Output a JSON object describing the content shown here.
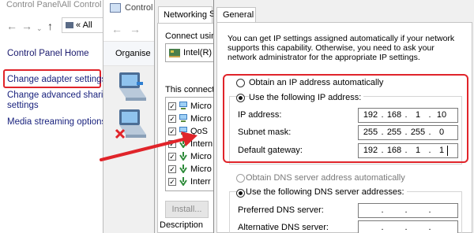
{
  "control_panel": {
    "title": "Control Panel\\All Control",
    "address": "« All",
    "home_link": "Control Panel Home",
    "links": [
      "Change adapter settings",
      "Change advanced sharing",
      "settings",
      "Media streaming options"
    ],
    "highlight_color": "#e0242a"
  },
  "network_connections": {
    "title": "Control",
    "toolbar_label": "Organise",
    "adapters": [
      "network-adapter-icon",
      "network-adapter-disabled-icon"
    ]
  },
  "adapter_properties": {
    "tabs": [
      "Networking",
      "S"
    ],
    "connect_using_label": "Connect using",
    "adapter_name": "Intel(R)",
    "connection_items_label": "This connecti",
    "items": [
      {
        "label": "Micro",
        "checked": true
      },
      {
        "label": "Micro",
        "checked": true
      },
      {
        "label": "QoS",
        "checked": true
      },
      {
        "label": "Intern",
        "checked": true
      },
      {
        "label": "Micro",
        "checked": true
      },
      {
        "label": "Micro",
        "checked": true
      },
      {
        "label": "Interr",
        "checked": true
      }
    ],
    "install_button": "Install...",
    "description_label": "Description"
  },
  "ipv4_dialog": {
    "tab": "General",
    "description": "You can get IP settings assigned automatically if your network supports this capability. Otherwise, you need to ask your network administrator for the appropriate IP settings.",
    "radio_auto_ip": "Obtain an IP address automatically",
    "radio_manual_ip": "Use the following IP address:",
    "fields": [
      {
        "label": "IP address:",
        "octets": [
          "192",
          "168",
          "1",
          "10"
        ]
      },
      {
        "label": "Subnet mask:",
        "octets": [
          "255",
          "255",
          "255",
          "0"
        ]
      },
      {
        "label": "Default gateway:",
        "octets": [
          "192",
          "168",
          "1",
          "1"
        ]
      }
    ],
    "radio_auto_dns": "Obtain DNS server address automatically",
    "radio_manual_dns": "Use the following DNS server addresses:",
    "dns_fields": [
      {
        "label": "Preferred DNS server:"
      },
      {
        "label": "Alternative DNS server:"
      }
    ],
    "highlight_color": "#e0242a"
  }
}
